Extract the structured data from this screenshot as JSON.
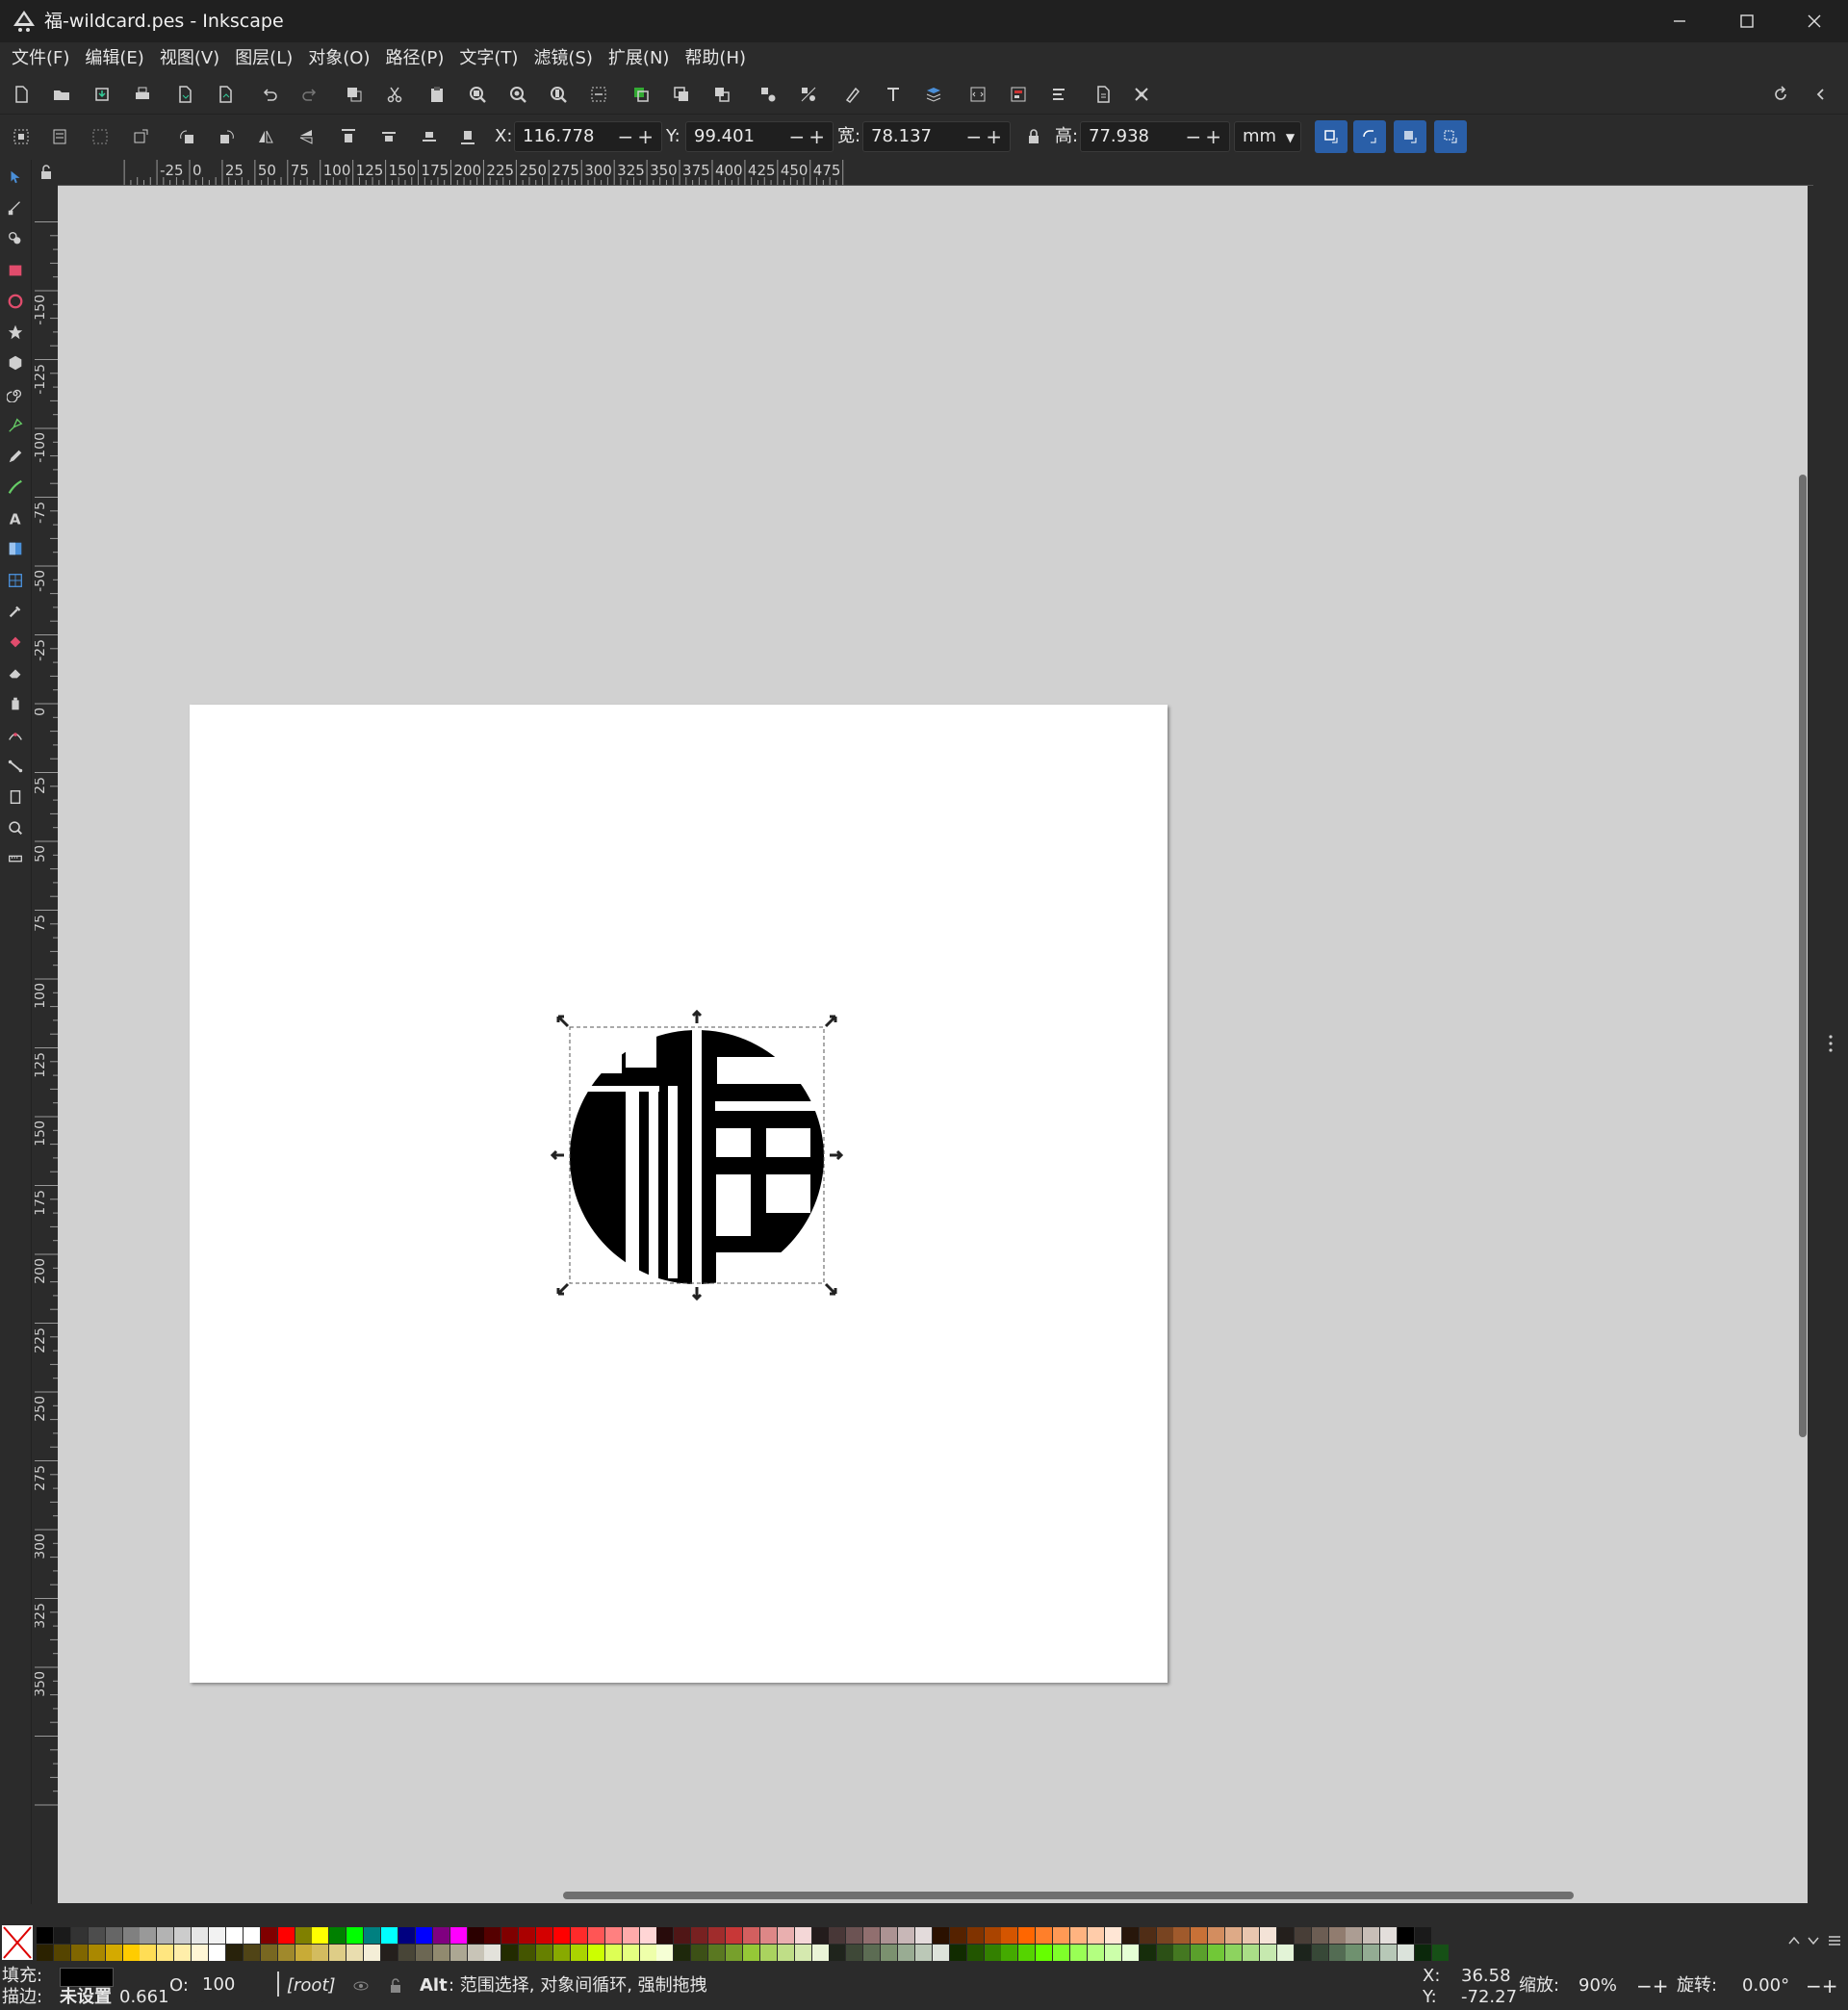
{
  "window": {
    "title": "福-wildcard.pes - Inkscape",
    "controls": {
      "minimize": "minimize-icon",
      "maximize": "maximize-icon",
      "close": "close-icon"
    }
  },
  "menu": [
    "文件(F)",
    "编辑(E)",
    "视图(V)",
    "图层(L)",
    "对象(O)",
    "路径(P)",
    "文字(T)",
    "滤镜(S)",
    "扩展(N)",
    "帮助(H)"
  ],
  "toolbar": {
    "commands": [
      "new-document-icon",
      "open-icon",
      "save-icon",
      "print-icon",
      "import-icon",
      "export-icon",
      "undo-icon",
      "redo-icon",
      "copy-icon",
      "cut-icon",
      "paste-icon",
      "zoom-selection-icon",
      "zoom-drawing-icon",
      "zoom-page-icon",
      "zoom-page-width-icon",
      "duplicate-icon",
      "clone-icon",
      "unlink-clone-icon",
      "group-icon",
      "ungroup-icon",
      "fill-stroke-icon",
      "text-font-icon",
      "layers-icon",
      "xml-editor-icon",
      "align-distribute-icon",
      "object-properties-icon",
      "document-properties-icon",
      "preferences-icon"
    ],
    "right": [
      "reset-icon",
      "collapse-left-icon"
    ]
  },
  "controls": {
    "x_label": "X:",
    "x_value": "116.778",
    "y_label": "Y:",
    "y_value": "99.401",
    "w_label": "宽:",
    "w_value": "78.137",
    "h_label": "高:",
    "h_value": "77.938",
    "unit": "mm",
    "spin_buttons": "−+"
  },
  "ruler": {
    "top_labels": [
      "-25",
      "0",
      "25",
      "50",
      "75",
      "100",
      "125",
      "150",
      "175",
      "200",
      "225",
      "250",
      "275",
      "300",
      "325",
      "350",
      "375",
      "400",
      "425",
      "450",
      "475"
    ],
    "left_labels": [
      "-150",
      "-125",
      "-100",
      "-75",
      "-50",
      "-25",
      "0",
      "25",
      "50",
      "75",
      "100",
      "125",
      "150",
      "175",
      "200",
      "225",
      "250",
      "275",
      "300",
      "325",
      "350"
    ]
  },
  "tools": [
    "selector-icon",
    "node-icon",
    "tweak-icon",
    "rectangle-icon",
    "ellipse-icon",
    "star-icon",
    "3dbox-icon",
    "spiral-icon",
    "pen-icon",
    "pencil-icon",
    "calligraphy-icon",
    "text-icon",
    "gradient-icon",
    "mesh-icon",
    "dropper-icon",
    "paint-bucket-icon",
    "eraser-icon",
    "spray-icon",
    "lpe-icon",
    "connector-icon",
    "pages-icon",
    "zoom-icon",
    "measure-icon"
  ],
  "canvas": {
    "page_color": "#ffffff",
    "desk_color": "#d1d1d1",
    "object": "福 glyph"
  },
  "palette": {
    "row1": [
      "#000000",
      "#1a1a1a",
      "#333333",
      "#4d4d4d",
      "#666666",
      "#808080",
      "#999999",
      "#b3b3b3",
      "#cccccc",
      "#e6e6e6",
      "#f2f2f2",
      "#ffffff",
      "#ffffff",
      "#800000",
      "#ff0000",
      "#808000",
      "#ffff00",
      "#008000",
      "#00ff00",
      "#008080",
      "#00ffff",
      "#000080",
      "#0000ff",
      "#800080",
      "#ff00ff",
      "#2b0000",
      "#550000",
      "#800000",
      "#aa0000",
      "#d40000",
      "#ff0000",
      "#ff2a2a",
      "#ff5555",
      "#ff8080",
      "#ffaaaa",
      "#ffd5d5",
      "#280b0b",
      "#501616",
      "#782121",
      "#a02c2c",
      "#c83737",
      "#d35f5f",
      "#de8787",
      "#e9afaf",
      "#f4d7d7",
      "#241c1c",
      "#483737",
      "#6c5353",
      "#916f6f",
      "#ac9393",
      "#c8b7b7",
      "#e3dbdb",
      "#2b1100",
      "#552200",
      "#803300",
      "#aa4400",
      "#d45500",
      "#ff6600",
      "#ff7f2a",
      "#ff9955",
      "#ffb380",
      "#ffccaa",
      "#ffe6d5",
      "#28170b",
      "#502d16",
      "#784421",
      "#a05a2c",
      "#c87137",
      "#d38d5f",
      "#deaa87",
      "#e9c6af",
      "#f4e3d7",
      "#241f1c",
      "#483e37",
      "#6c5d53",
      "#917c6f",
      "#ac9d93",
      "#c8beb7",
      "#e3dedb",
      "#000000",
      "#1a1a1a"
    ],
    "row2": [
      "#2b2200",
      "#554400",
      "#806600",
      "#aa8800",
      "#d4aa00",
      "#ffcc00",
      "#ffdd55",
      "#ffe680",
      "#ffeeaa",
      "#fff6d5",
      "#ffffff",
      "#28220b",
      "#504416",
      "#786721",
      "#a0892c",
      "#c8ab37",
      "#d3bc5f",
      "#decd87",
      "#e9ddaf",
      "#f4eed7",
      "#241f1c",
      "#484537",
      "#6c6753",
      "#918a6f",
      "#aca793",
      "#c8c4b7",
      "#e3e2db",
      "#222b00",
      "#445500",
      "#668000",
      "#88aa00",
      "#aad400",
      "#ccff00",
      "#ddff55",
      "#e5ff80",
      "#eeffaa",
      "#f6ffd5",
      "#1e280b",
      "#3c5016",
      "#5a7821",
      "#77a02c",
      "#95c837",
      "#aad35f",
      "#bfde87",
      "#d5e9af",
      "#eaf4d7",
      "#1f241c",
      "#3e4837",
      "#5c6c53",
      "#7b916f",
      "#99ac93",
      "#bbc8b7",
      "#dde3db",
      "#112b00",
      "#225500",
      "#338000",
      "#44aa00",
      "#55d400",
      "#66ff00",
      "#7fff2a",
      "#99ff55",
      "#b3ff80",
      "#ccffaa",
      "#e5ffd5",
      "#162d0b",
      "#2c5016",
      "#447821",
      "#5aa02c",
      "#71c837",
      "#8dd35f",
      "#aade87",
      "#c6e9af",
      "#e3f4d7",
      "#1c241c",
      "#374837",
      "#536c53",
      "#6f916f",
      "#93ac93",
      "#b7c8b7",
      "#dbe3db",
      "#0b280b",
      "#165016"
    ]
  },
  "status": {
    "fill_label": "填充:",
    "stroke_label": "描边:",
    "stroke_value": "未设置",
    "stroke_width": "0.661",
    "opacity_label": "O:",
    "opacity_value": "100",
    "layer": "[root]",
    "message_key": "Alt",
    "message": ": 范围选择, 对象间循环, 强制拖拽",
    "x_label": "X:",
    "x_value": "36.58",
    "y_label": "Y:",
    "y_value": "-72.27",
    "zoom_label": "缩放:",
    "zoom_value": "90%",
    "rotate_label": "旋转:",
    "rotate_value": "0.00°"
  }
}
